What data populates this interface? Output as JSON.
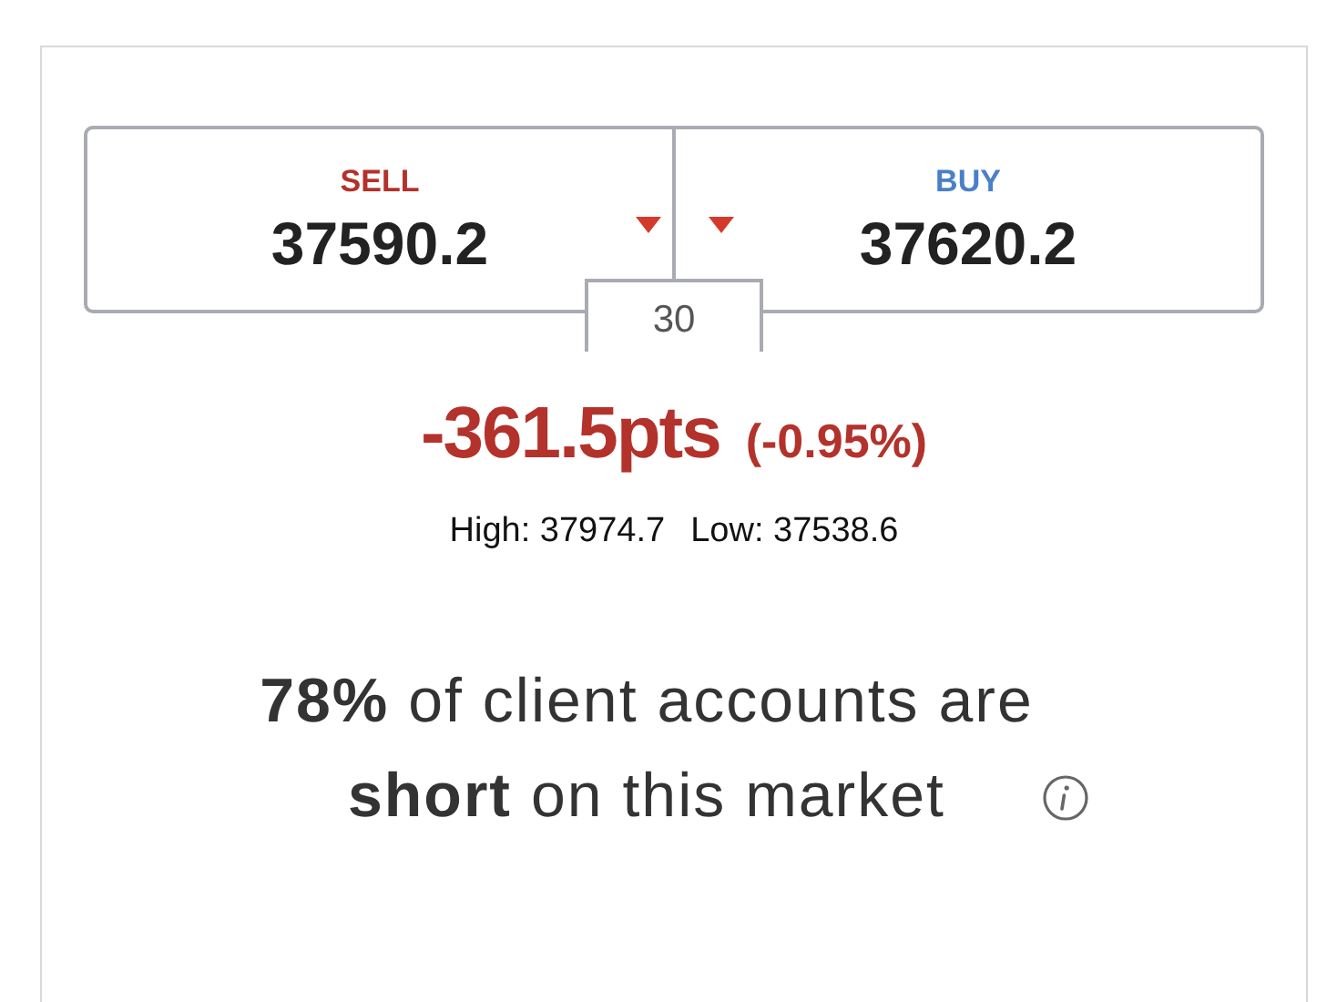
{
  "prices": [
    {
      "label": "SELL",
      "kind": "sell",
      "value": "37590.2",
      "falling": true
    },
    {
      "label": "BUY",
      "kind": "buy",
      "value": "37620.2",
      "falling": true
    }
  ],
  "spread": "30",
  "change": {
    "points": "-361.5pts",
    "percent": "(-0.95%)"
  },
  "range": {
    "high": "High: 37974.7",
    "low": "Low: 37538.6"
  },
  "sentiment": "**78%** of client accounts are **short** on this market"
}
